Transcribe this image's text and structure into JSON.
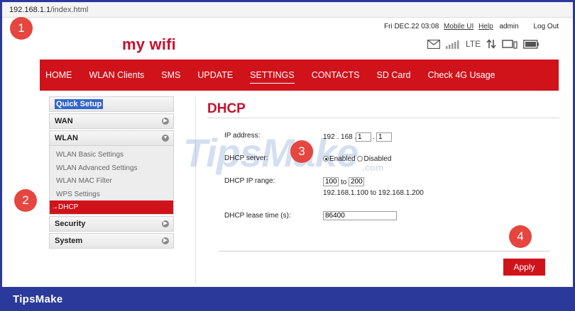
{
  "browser": {
    "url_host": "192.168.1.1",
    "url_path": "/index.html"
  },
  "header": {
    "datetime": "Fri DEC.22  03:08",
    "mobile_ui": "Mobile UI",
    "help": "Help",
    "user": "admin",
    "logout": "Log Out",
    "network_type": "LTE"
  },
  "logo": "my wifi",
  "nav": {
    "items": [
      {
        "label": "HOME"
      },
      {
        "label": "WLAN Clients"
      },
      {
        "label": "SMS"
      },
      {
        "label": "UPDATE"
      },
      {
        "label": "SETTINGS",
        "active": true
      },
      {
        "label": "CONTACTS"
      },
      {
        "label": "SD Card"
      },
      {
        "label": "Check 4G Usage"
      }
    ]
  },
  "sidebar": {
    "quick_setup": "Quick Setup",
    "wan": "WAN",
    "wlan": "WLAN",
    "wlan_sub": [
      {
        "label": "WLAN Basic Settings"
      },
      {
        "label": "WLAN Advanced Settings"
      },
      {
        "label": "WLAN MAC Filter"
      },
      {
        "label": "WPS Settings"
      },
      {
        "label": "→DHCP",
        "active": true
      }
    ],
    "security": "Security",
    "system": "System"
  },
  "content": {
    "title": "DHCP",
    "ip_address_label": "IP address:",
    "ip_part1": "192",
    "ip_part2": "168",
    "ip_part3": "1",
    "ip_part4": "1",
    "dhcp_server_label": "DHCP server:",
    "enabled": "Enabled",
    "disabled": "Disabled",
    "dhcp_range_label": "DHCP IP range:",
    "range_start": "100",
    "range_to": "to",
    "range_end": "200",
    "range_full": "192.168.1.100 to 192.168.1.200",
    "lease_label": "DHCP lease time (s):",
    "lease_value": "86400",
    "apply": "Apply"
  },
  "markers": [
    "1",
    "2",
    "3",
    "4"
  ],
  "watermark": {
    "main": "TipsMake",
    "sub": ".com"
  },
  "footer": {
    "brand": "TipsMake"
  },
  "colors": {
    "brand_red": "#d0121b",
    "frame_blue": "#2b3a9a",
    "marker_red": "#e5463f"
  }
}
